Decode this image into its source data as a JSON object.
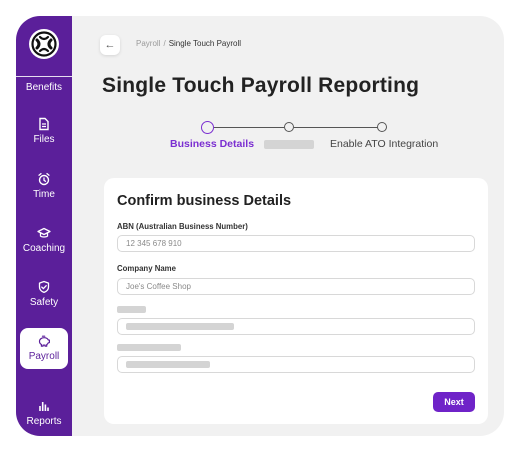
{
  "sidebar": {
    "items": [
      {
        "label": "Benefits",
        "icon": "gift-icon"
      },
      {
        "label": "Files",
        "icon": "file-icon"
      },
      {
        "label": "Time",
        "icon": "alarm-clock-icon"
      },
      {
        "label": "Coaching",
        "icon": "graduation-cap-icon"
      },
      {
        "label": "Safety",
        "icon": "shield-check-icon"
      },
      {
        "label": "Payroll",
        "icon": "piggy-bank-icon",
        "active": true
      },
      {
        "label": "Reports",
        "icon": "bar-chart-icon"
      }
    ]
  },
  "breadcrumb": {
    "parent": "Payroll",
    "separator": "/",
    "current": "Single Touch Payroll"
  },
  "page": {
    "title": "Single Touch Payroll Reporting"
  },
  "stepper": {
    "steps": [
      {
        "label": "Business Details",
        "state": "active"
      },
      {
        "label": "",
        "state": "pending"
      },
      {
        "label": "Enable ATO Integration",
        "state": "pending"
      }
    ]
  },
  "form": {
    "title": "Confirm business Details",
    "abn_label": "ABN (Australian Business Number)",
    "abn_placeholder": "12 345 678 910",
    "company_label": "Company Name",
    "company_placeholder": "Joe's Coffee Shop",
    "next_label": "Next"
  },
  "colors": {
    "sidebar": "#5b1f9a",
    "accent": "#7b2fd1",
    "button": "#6f23c8",
    "background": "#f1f1f1"
  }
}
